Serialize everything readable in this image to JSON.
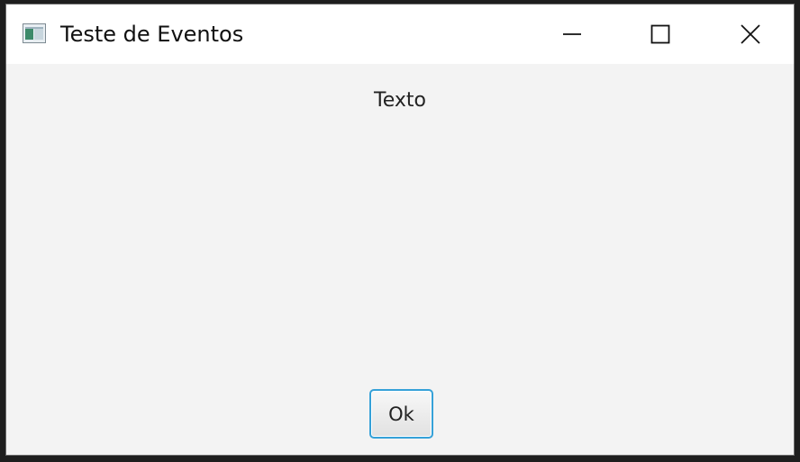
{
  "window": {
    "title": "Teste de Eventos",
    "app_icon": "java-app-icon",
    "controls": {
      "minimize_icon": "minimize-icon",
      "maximize_icon": "maximize-icon",
      "close_icon": "close-icon"
    }
  },
  "content": {
    "label_text": "Texto",
    "ok_button_label": "Ok"
  },
  "colors": {
    "titlebar_bg": "#ffffff",
    "content_bg": "#f3f3f3",
    "button_focus_border": "#35a1d8",
    "text": "#222222"
  }
}
